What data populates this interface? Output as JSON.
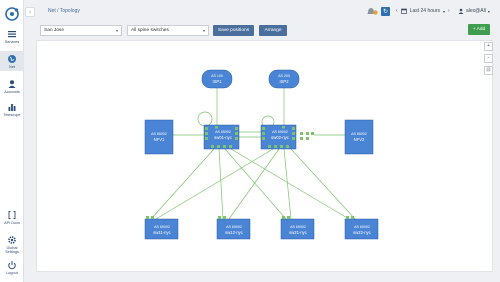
{
  "sidebar": {
    "items": [
      {
        "label": "Services",
        "icon": "list-icon"
      },
      {
        "label": "Net",
        "icon": "globe-icon"
      },
      {
        "label": "Accounts",
        "icon": "user-icon"
      },
      {
        "label": "Telescope",
        "icon": "bar-chart-icon"
      },
      {
        "label": "API Docs",
        "icon": "brackets-icon"
      },
      {
        "label": "Global Settings",
        "icon": "gear-icon"
      },
      {
        "label": "Logout",
        "icon": "power-icon"
      }
    ]
  },
  "header": {
    "collapse": "‹",
    "breadcrumb": "Net / Topology",
    "time_range": "Last 24 hours",
    "time_prev": "‹",
    "time_next": "›",
    "user": "alex@All"
  },
  "toolbar": {
    "site_select": "San Jose",
    "filter_select": "All spine switches",
    "save_label": "Save positions",
    "arrange_label": "Arrange",
    "add_label": "+ Add"
  },
  "zoom": {
    "in": "+",
    "out": "-",
    "fit": "⊡"
  },
  "topology": {
    "isps": [
      {
        "model": "AS 100",
        "name": "ISP1"
      },
      {
        "model": "AS 200",
        "name": "ISP2"
      }
    ],
    "nfvs": [
      {
        "model": "AS 65002",
        "name": "NFV1"
      },
      {
        "model": "AS 65002",
        "name": "NFV2"
      }
    ],
    "spines": [
      {
        "model": "AS 65002",
        "name": "sw01-nyc"
      },
      {
        "model": "AS 65002",
        "name": "sw02-nyc"
      }
    ],
    "leaves": [
      {
        "model": "AS 65002",
        "name": "sw11-nyc"
      },
      {
        "model": "AS 65002",
        "name": "sw12-nyc"
      },
      {
        "model": "AS 65002",
        "name": "sw21-nyc"
      },
      {
        "model": "AS 65002",
        "name": "sw22-nyc"
      }
    ]
  },
  "colors": {
    "node": "#4a84d4",
    "node_border": "#2b5fa8",
    "link": "#7bc46a",
    "port": "#7bc46a",
    "primary_button": "#4b6f9c",
    "add_button": "#3f9d4f"
  }
}
